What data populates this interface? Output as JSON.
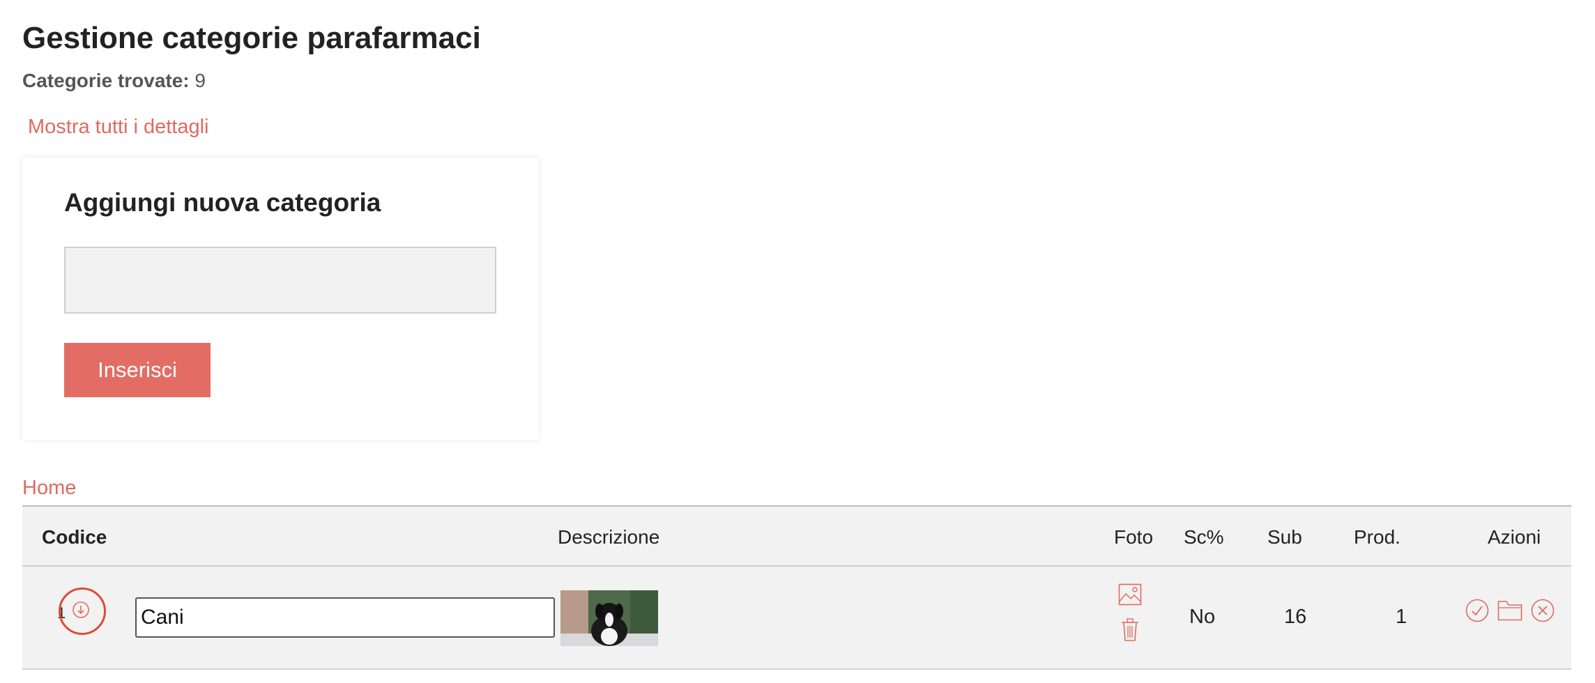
{
  "header": {
    "title": "Gestione categorie parafarmaci",
    "count_label": "Categorie trovate:",
    "count_value": "9",
    "details_link": "Mostra tutti i dettagli"
  },
  "add_form": {
    "title": "Aggiungi nuova categoria",
    "input_value": "",
    "submit_label": "Inserisci"
  },
  "breadcrumb": {
    "home": "Home"
  },
  "table": {
    "columns": {
      "code": "Codice",
      "description": "Descrizione",
      "photo": "Foto",
      "discount": "Sc%",
      "sub": "Sub",
      "products": "Prod.",
      "actions": "Azioni"
    },
    "rows": [
      {
        "code": "1",
        "description": "Cani",
        "discount": "No",
        "sub": "16",
        "products": "1"
      }
    ]
  },
  "icons": {
    "sort": "arrow-down-circle-icon",
    "photo": "image-icon",
    "delete_photo": "trash-icon",
    "confirm": "check-circle-icon",
    "open": "folder-icon",
    "remove": "close-circle-icon"
  },
  "colors": {
    "accent": "#e36d64",
    "link": "#e06a5f",
    "highlight_ring": "#e04a33",
    "table_bg": "#f2f2f2"
  }
}
